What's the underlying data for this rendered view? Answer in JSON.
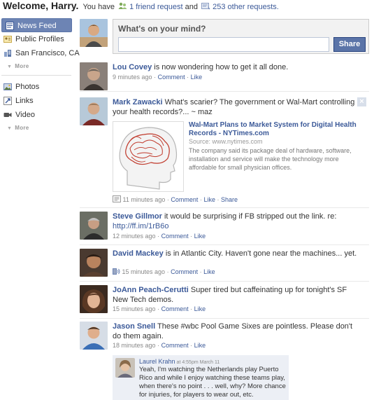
{
  "header": {
    "welcome": "Welcome, Harry.",
    "you_have": "You have",
    "friend_requests": "1 friend request",
    "and": "and",
    "other_requests": "253 other requests."
  },
  "sidebar": {
    "top_items": [
      {
        "label": "News Feed",
        "icon": "news-feed-icon"
      },
      {
        "label": "Public Profiles",
        "icon": "profiles-icon"
      },
      {
        "label": "San Francisco, CA",
        "icon": "network-icon"
      }
    ],
    "more_1": "More",
    "bottom_items": [
      {
        "label": "Photos",
        "icon": "photos-icon"
      },
      {
        "label": "Links",
        "icon": "links-icon"
      },
      {
        "label": "Video",
        "icon": "video-icon"
      }
    ],
    "more_2": "More"
  },
  "composer": {
    "prompt": "What's on your mind?",
    "share_label": "Share"
  },
  "actions": {
    "comment": "Comment",
    "like": "Like",
    "share": "Share",
    "sep": "·"
  },
  "stories": [
    {
      "name": "Lou Covey",
      "text": "is now wondering how to get it all done.",
      "time": "9 minutes ago"
    },
    {
      "name": "Mark Zawacki",
      "text": "What's scarier? The government or Wal-Mart controlling your health records?... ~ maz",
      "time": "11 minutes ago",
      "attachment": {
        "title": "Wal-Mart Plans to Market System for Digital Health Records - NYTimes.com",
        "source": "Source: www.nytimes.com",
        "description": "The company said its package deal of hardware, software, installation and service will make the technology more affordable for small physician offices."
      }
    },
    {
      "name": "Steve Gillmor",
      "text": "it would be surprising if FB stripped out the link. re:",
      "link": "http://ff.im/1rB6o",
      "time": "12 minutes ago"
    },
    {
      "name": "David Mackey",
      "text": "is in Atlantic City. Haven't gone near the machines... yet.",
      "time": "15 minutes ago"
    },
    {
      "name": "JoAnn Peach-Cerutti",
      "text": "Super tired but caffeinating up for tonight's SF New Tech demos.",
      "time": "15 minutes ago"
    },
    {
      "name": "Jason Snell",
      "text": "These #wbc Pool Game Sixes are pointless. Please don't do them again.",
      "time": "18 minutes ago"
    }
  ],
  "comment": {
    "name": "Laurel Krahn",
    "when": "at 4:55pm March 11",
    "text": "Yeah, I'm watching the Netherlands play Puerto Rico and while I enjoy watching these teams play, when there's no point . . . well, why? More chance for injuries, for players to wear out, etc."
  },
  "colors": {
    "brand_blue": "#3b5998",
    "active_nav": "#6d84b4",
    "share_button": "#5b74a8",
    "comment_bg": "#eceff5"
  }
}
